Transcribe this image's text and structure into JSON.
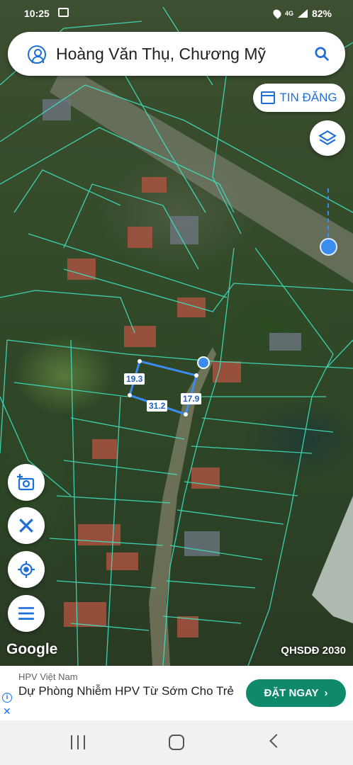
{
  "status_bar": {
    "time": "10:25",
    "network": "4G",
    "battery": "82%"
  },
  "search": {
    "query": "Hoàng Văn Thụ, Chương Mỹ"
  },
  "tin_dang": {
    "label": "TIN ĐĂNG"
  },
  "map": {
    "measurements": {
      "top_left": "19.3",
      "bottom": "31.2",
      "right": "17.9"
    },
    "google_label": "Google",
    "overlay_label": "QHSDĐ 2030"
  },
  "ad": {
    "advertiser": "HPV Việt Nam",
    "headline": "Dự Phòng Nhiễm HPV Từ Sớm Cho Trẻ",
    "cta": "ĐẶT NGAY",
    "cta_color": "#0e8a6b"
  },
  "colors": {
    "accent": "#1e6ed8",
    "parcel_line": "#3fe0c0"
  }
}
